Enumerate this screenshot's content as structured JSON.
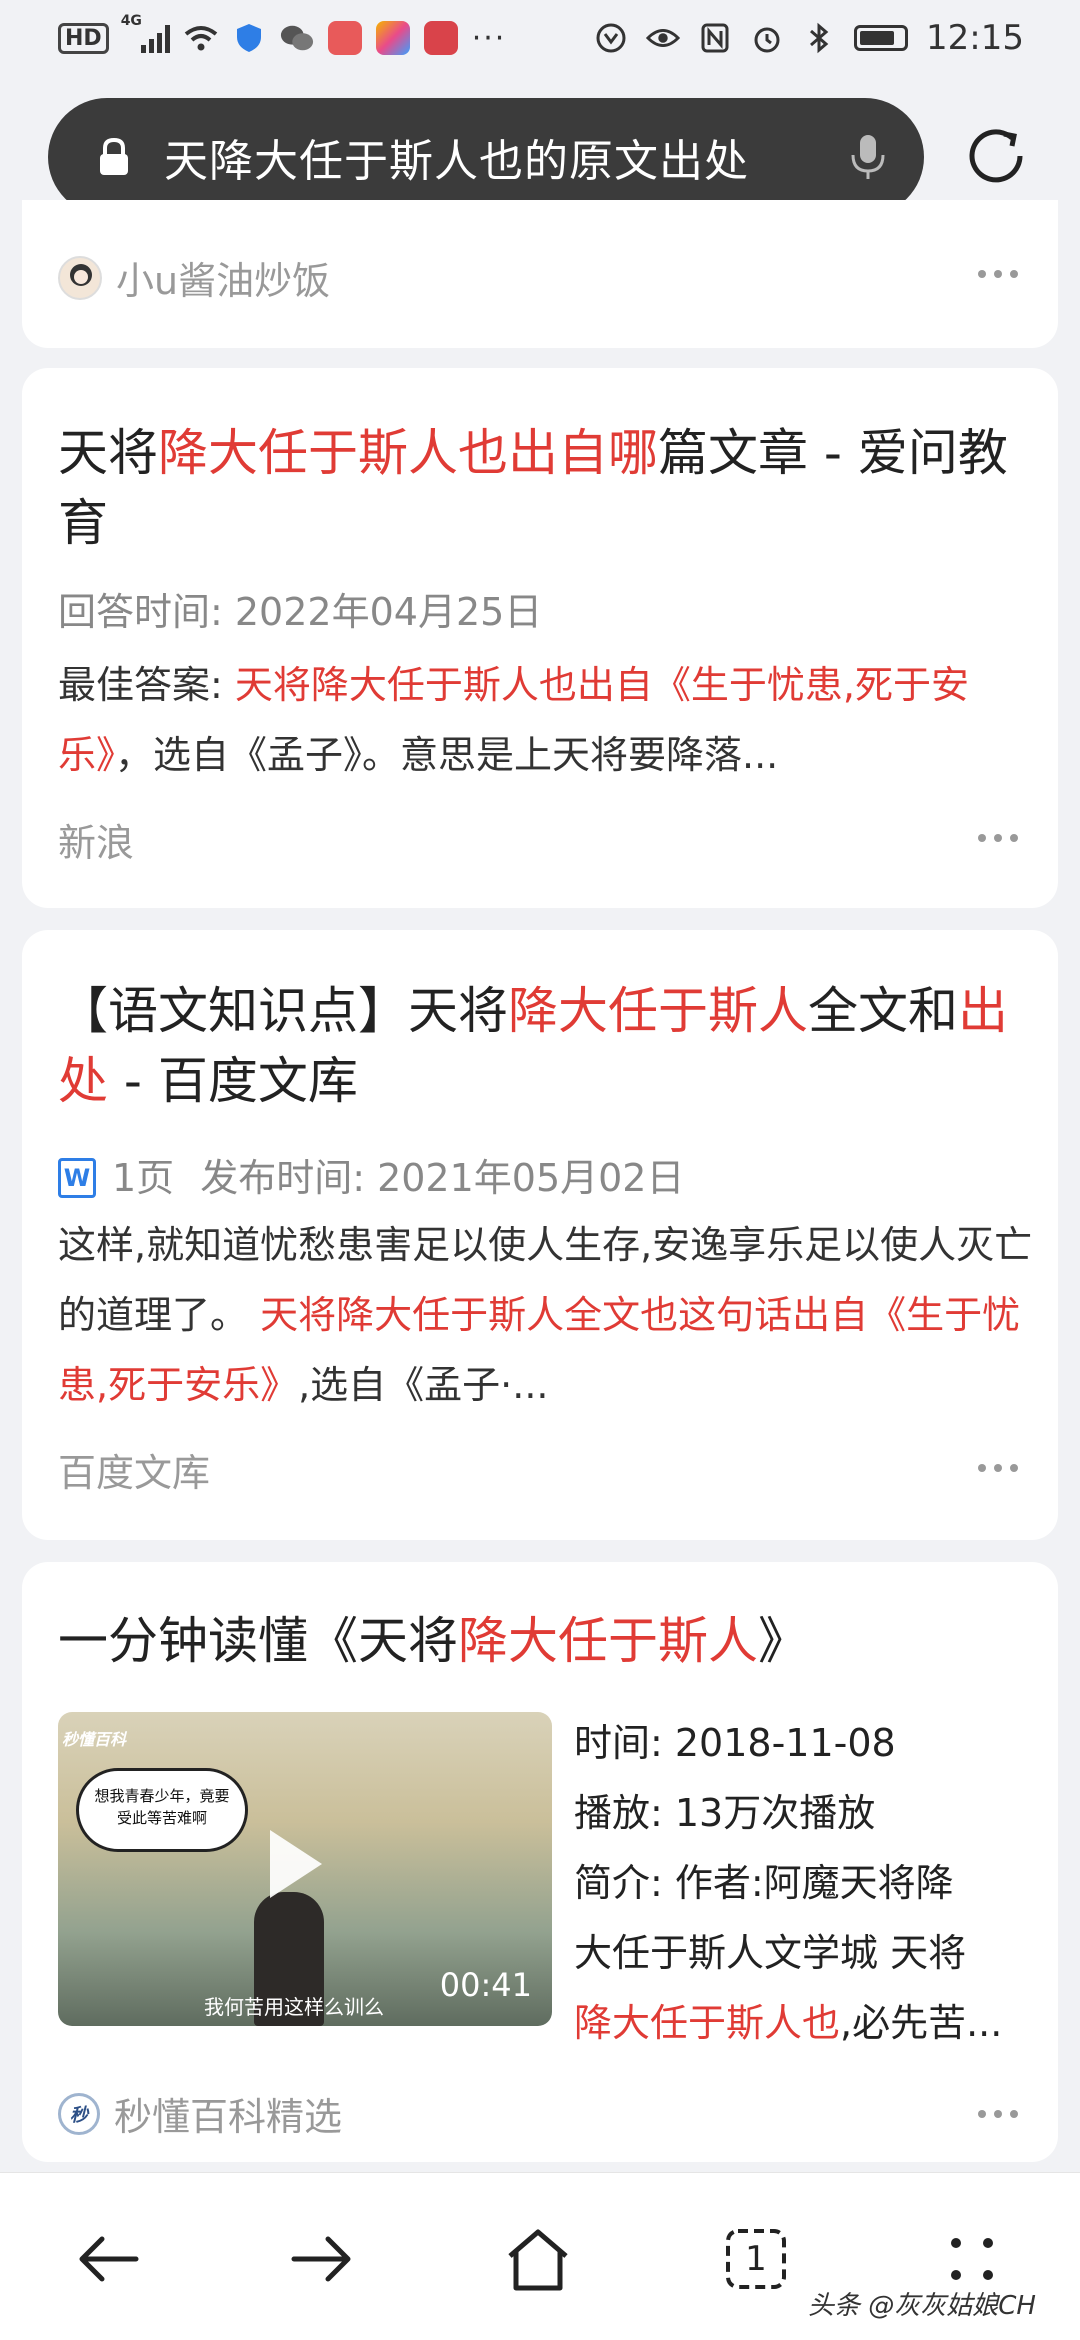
{
  "status_bar": {
    "network_label": "HD",
    "signal_label": "4G",
    "time": "12:15"
  },
  "address_bar": {
    "query": "天降大任于斯人也的原文出处"
  },
  "results": [
    {
      "source": "小u酱油炒饭"
    },
    {
      "title_parts": [
        "天将",
        "降大任于斯人也出自哪",
        "篇文章 - 爱问教育"
      ],
      "answer_time": "回答时间: 2022年04月25日",
      "best_answer_label": "最佳答案: ",
      "best_answer_red": "天将降大任于斯人也出自《生于忧患,死于安乐》",
      "best_answer_rest": "，选自《孟子》。意思是上天将要降落...",
      "source": "新浪"
    },
    {
      "title_parts": [
        "【语文知识点】天将",
        "降大任于斯人",
        "全文和",
        "出处",
        " - 百度文库"
      ],
      "doc_icon": "W",
      "pages": "1页",
      "publish_time": "发布时间: 2021年05月02日",
      "snippet_plain": "这样,就知道忧愁患害足以使人生存,安逸享乐足以使人灭亡的道理了。 ",
      "snippet_red": "天将降大任于斯人全文也这句话出自《生于忧患,死于安乐》",
      "snippet_rest": ",选自《孟子·...",
      "source": "百度文库"
    },
    {
      "title_parts": [
        "一分钟读懂《天将",
        "降大任于斯人",
        "》"
      ],
      "video": {
        "brand": "秒懂百科",
        "bubble_text": "想我青春少年，竟要受此等苦难啊",
        "subtitle": "我何苦用这样么训么",
        "duration": "00:41"
      },
      "time_row": "时间:  2018-11-08",
      "play_row": "播放:  13万次播放",
      "intro_row": "简介:   作者:阿魔天将降",
      "intro_row2": "大任于斯人文学城 天将",
      "intro_red": "降大任于斯人也",
      "intro_rest": ",必先苦...",
      "source": "秒懂百科精选",
      "source_badge": "秒"
    }
  ],
  "watermark": "头条 @灰灰姑娘CH",
  "nav": {
    "tab_count": "1"
  }
}
